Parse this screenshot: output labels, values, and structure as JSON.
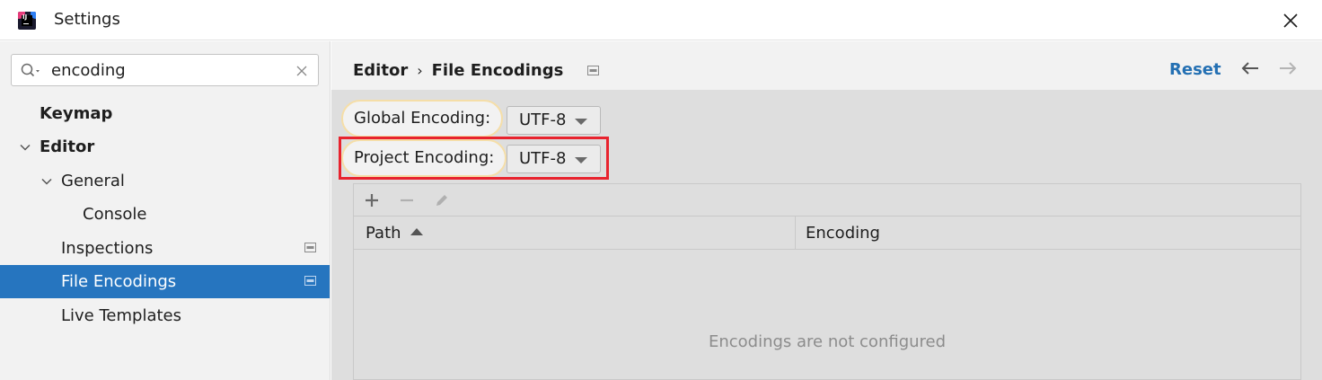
{
  "window": {
    "title": "Settings",
    "logo_text": "IJ"
  },
  "sidebar": {
    "search": {
      "value": "encoding",
      "placeholder": ""
    },
    "items": [
      {
        "label": "Keymap",
        "bold": true,
        "expanded": null,
        "selected": false
      },
      {
        "label": "Editor",
        "bold": true,
        "expanded": true,
        "selected": false
      },
      {
        "label": "General",
        "bold": false,
        "expanded": true,
        "selected": false
      },
      {
        "label": "Console",
        "bold": false,
        "expanded": null,
        "selected": false
      },
      {
        "label": "Inspections",
        "bold": false,
        "expanded": null,
        "selected": false,
        "project_icon": true
      },
      {
        "label": "File Encodings",
        "bold": false,
        "expanded": null,
        "selected": true,
        "project_icon": true
      },
      {
        "label": "Live Templates",
        "bold": false,
        "expanded": null,
        "selected": false
      }
    ]
  },
  "header": {
    "breadcrumb": [
      "Editor",
      "File Encodings"
    ],
    "separator": "›",
    "reset_label": "Reset"
  },
  "encodings": {
    "global_label": "Global Encoding:",
    "global_value": "UTF-8",
    "project_label": "Project Encoding:",
    "project_value": "UTF-8"
  },
  "table": {
    "toolbar": [
      "add-icon",
      "remove-icon",
      "edit-icon"
    ],
    "columns": [
      "Path",
      "Encoding"
    ],
    "sorted_column": "Path",
    "empty_text": "Encodings are not configured"
  },
  "colors": {
    "selection": "#2675bf",
    "link": "#2470b3",
    "highlight": "#e8232e",
    "label_outline": "#f5dea8"
  }
}
